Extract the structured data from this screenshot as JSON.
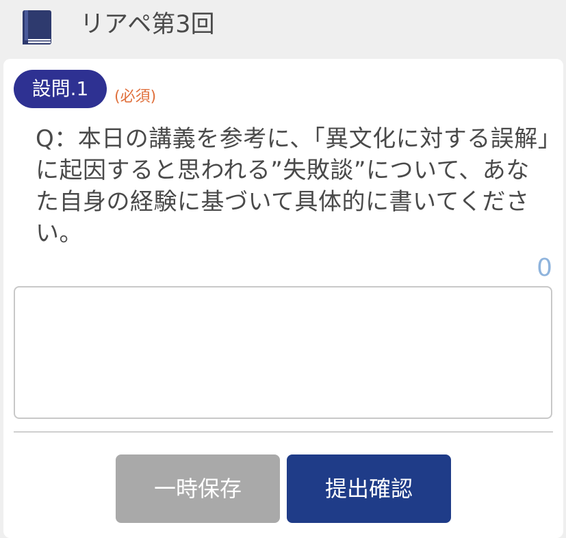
{
  "header": {
    "icon": "book-icon",
    "title": "リアペ第3回"
  },
  "question": {
    "badge": "設問.1",
    "required_label": "(必須)",
    "text": "Q：本日の講義を参考に、「異文化に対する誤解」に起因すると思われる”失敗談”について、あなた自身の経験に基づいて具体的に書いてください。"
  },
  "answer": {
    "char_count": "0",
    "value": ""
  },
  "buttons": {
    "save_label": "一時保存",
    "submit_label": "提出確認"
  },
  "colors": {
    "badge": "#2e3192",
    "required": "#e0703c",
    "count": "#8fb4dd",
    "save_button": "#a9a9a9",
    "submit_button": "#1f3c88"
  }
}
